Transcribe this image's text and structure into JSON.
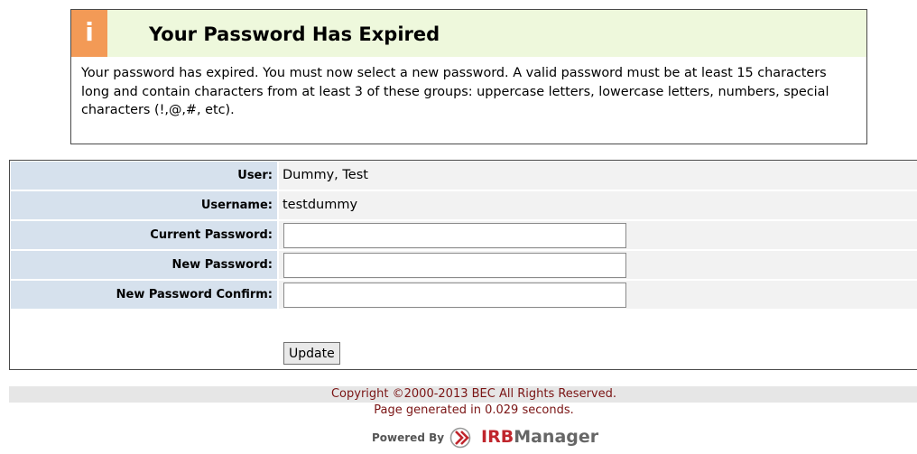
{
  "notice": {
    "icon_glyph": "i",
    "icon_name": "info-icon",
    "title": "Your Password Has Expired",
    "body": "Your password has expired. You must now select a new password. A valid password must be at least 15 characters long and contain characters from at least 3 of these groups: uppercase letters, lowercase letters, numbers, special characters (!,@,#, etc).",
    "colors": {
      "header_bg": "#eef8dc",
      "icon_bg": "#f39a56"
    }
  },
  "form": {
    "user_label": "User:",
    "user_value": "Dummy, Test",
    "username_label": "Username:",
    "username_value": "testdummy",
    "current_password_label": "Current Password:",
    "current_password_value": "",
    "new_password_label": "New Password:",
    "new_password_value": "",
    "confirm_password_label": "New Password Confirm:",
    "confirm_password_value": "",
    "update_button": "Update",
    "colors": {
      "label_bg": "#d6e1ed",
      "value_bg": "#f2f2f2"
    }
  },
  "footer": {
    "copyright": "Copyright ©2000-2013 BEC All Rights Reserved.",
    "generated": "Page generated in 0.029 seconds.",
    "powered_by": "Powered By",
    "brand_part1": "IRB",
    "brand_part2": "Manager",
    "colors": {
      "text": "#7a1414",
      "brand_red": "#c0262d"
    }
  }
}
